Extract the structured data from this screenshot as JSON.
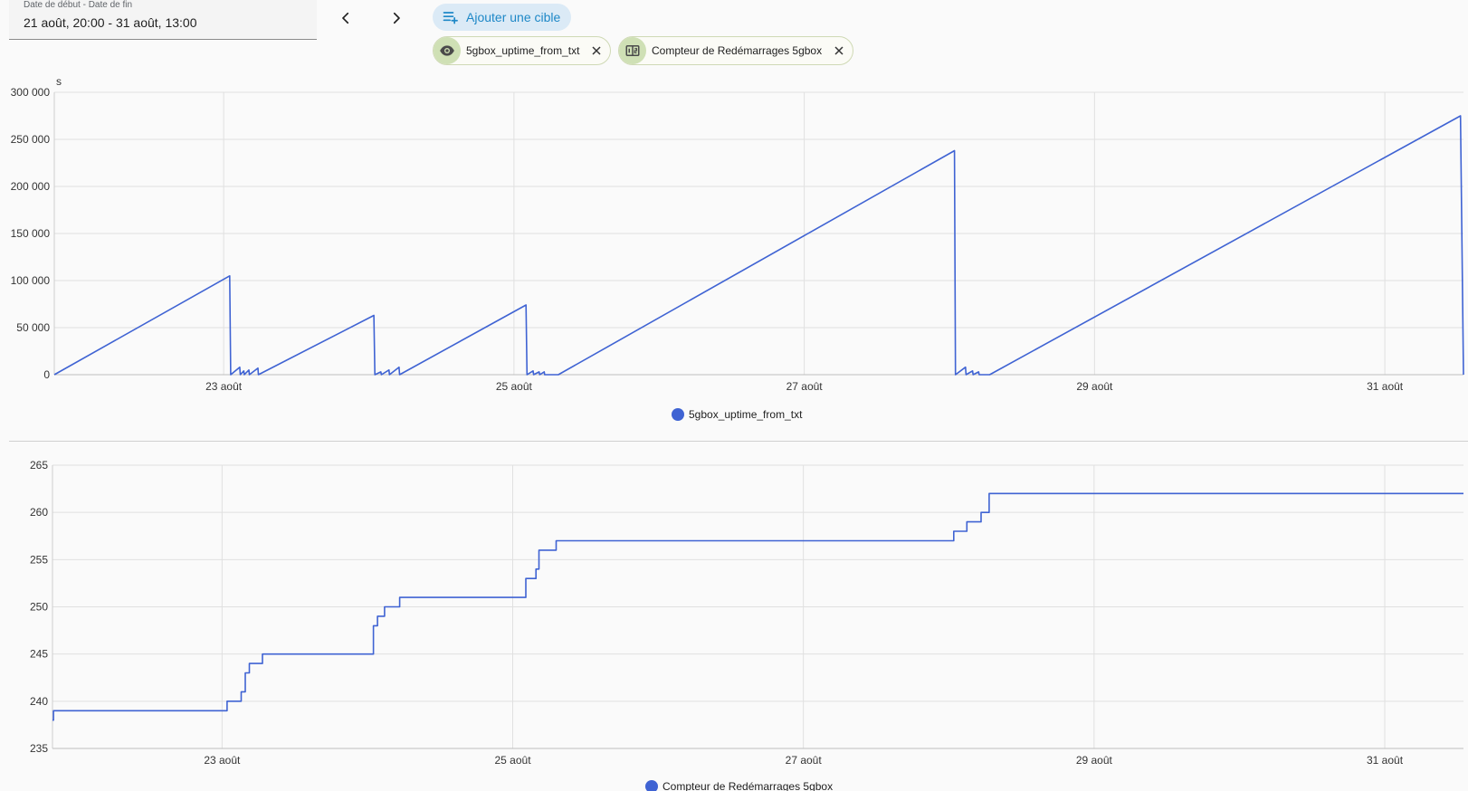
{
  "date_range": {
    "label": "Date de début - Date de fin",
    "value": "21 août, 20:00 - 31 août, 13:00"
  },
  "nav": {
    "prev_icon": "chevron-left-icon",
    "next_icon": "chevron-right-icon"
  },
  "add_target": {
    "label": "Ajouter une cible",
    "icon": "playlist-add-icon"
  },
  "chips": [
    {
      "label": "5gbox_uptime_from_txt",
      "icon": "eye-icon"
    },
    {
      "label": "Compteur de Redémarrages 5gbox",
      "icon": "counter-icon"
    }
  ],
  "colors": {
    "series": "#3f63d3",
    "accent": "#1e88c7",
    "chip_bg": "#cfe0b5"
  },
  "chart_data": [
    {
      "type": "line",
      "unit_label": "s",
      "x_ticks": [
        "23 août",
        "25 août",
        "27 août",
        "29 août",
        "31 août"
      ],
      "y_ticks": [
        "0",
        "50 000",
        "100 000",
        "150 000",
        "200 000",
        "250 000",
        "300 000"
      ],
      "ylim": [
        0,
        300000
      ],
      "xlim": [
        "21 août 20:00",
        "31 août 13:00"
      ],
      "grid": true,
      "legend_position": "bottom",
      "series": [
        {
          "name": "5gbox_uptime_from_txt",
          "points": [
            [
              "21 août 20:00",
              0
            ],
            [
              "23 août 01:00",
              105000
            ],
            [
              "23 août 01:10",
              0
            ],
            [
              "23 août 02:40",
              8000
            ],
            [
              "23 août 02:45",
              0
            ],
            [
              "23 août 03:20",
              4000
            ],
            [
              "23 août 03:25",
              0
            ],
            [
              "23 août 04:10",
              5000
            ],
            [
              "23 août 04:15",
              0
            ],
            [
              "23 août 05:40",
              7000
            ],
            [
              "23 août 05:45",
              0
            ],
            [
              "24 août 00:50",
              63000
            ],
            [
              "24 août 01:00",
              0
            ],
            [
              "24 août 02:00",
              3000
            ],
            [
              "24 août 02:05",
              0
            ],
            [
              "24 août 03:20",
              5000
            ],
            [
              "24 août 03:25",
              0
            ],
            [
              "24 août 05:00",
              8000
            ],
            [
              "24 août 05:05",
              0
            ],
            [
              "25 août 02:00",
              74000
            ],
            [
              "25 août 02:10",
              0
            ],
            [
              "25 août 03:10",
              4000
            ],
            [
              "25 août 03:15",
              0
            ],
            [
              "25 août 04:10",
              3000
            ],
            [
              "25 août 04:15",
              0
            ],
            [
              "25 août 05:00",
              3000
            ],
            [
              "25 août 05:05",
              0
            ],
            [
              "25 août 07:20",
              0
            ],
            [
              "28 août 00:50",
              238000
            ],
            [
              "28 août 01:00",
              0
            ],
            [
              "28 août 02:40",
              8000
            ],
            [
              "28 août 02:45",
              0
            ],
            [
              "28 août 03:50",
              4000
            ],
            [
              "28 août 03:55",
              0
            ],
            [
              "28 août 04:50",
              3000
            ],
            [
              "28 août 04:55",
              0
            ],
            [
              "28 août 06:40",
              0
            ],
            [
              "31 août 12:30",
              275000
            ],
            [
              "31 août 13:00",
              0
            ]
          ]
        }
      ]
    },
    {
      "type": "line",
      "step": true,
      "x_ticks": [
        "23 août",
        "25 août",
        "27 août",
        "29 août",
        "31 août"
      ],
      "y_ticks": [
        "235",
        "240",
        "245",
        "250",
        "255",
        "260",
        "265"
      ],
      "ylim": [
        235,
        265
      ],
      "xlim": [
        "21 août 20:00",
        "31 août 13:00"
      ],
      "grid": true,
      "legend_position": "bottom",
      "series": [
        {
          "name": "Compteur de Redémarrages 5gbox",
          "points": [
            [
              "21 août 20:00",
              238
            ],
            [
              "21 août 20:10",
              239
            ],
            [
              "23 août 00:50",
              240
            ],
            [
              "23 août 03:10",
              241
            ],
            [
              "23 août 03:50",
              243
            ],
            [
              "23 août 04:30",
              244
            ],
            [
              "23 août 06:40",
              245
            ],
            [
              "24 août 01:00",
              248
            ],
            [
              "24 août 01:40",
              249
            ],
            [
              "24 août 02:50",
              250
            ],
            [
              "24 août 05:20",
              251
            ],
            [
              "25 août 02:10",
              253
            ],
            [
              "25 août 03:50",
              254
            ],
            [
              "25 août 04:20",
              256
            ],
            [
              "25 août 07:10",
              257
            ],
            [
              "28 août 00:50",
              258
            ],
            [
              "28 août 03:00",
              259
            ],
            [
              "28 août 05:20",
              260
            ],
            [
              "28 août 06:40",
              262
            ],
            [
              "31 août 13:00",
              262
            ]
          ]
        }
      ]
    }
  ]
}
